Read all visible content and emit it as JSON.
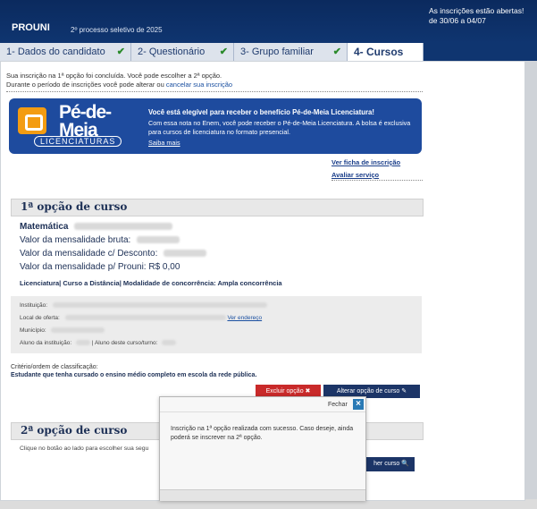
{
  "header": {
    "brand": "PROUNI",
    "process": "2º processo seletivo de 2025",
    "notice": "As inscrições estão abertas! de 30/06 a 04/07"
  },
  "tabs": [
    {
      "label": "1- Dados do candidato",
      "done": true
    },
    {
      "label": "2- Questionário",
      "done": true
    },
    {
      "label": "3- Grupo familiar",
      "done": true
    },
    {
      "label": "4- Cursos",
      "done": false,
      "active": true
    }
  ],
  "info": {
    "line1": "Sua inscrição na 1ª opção foi concluída. Você pode escolher a 2ª opção.",
    "line2": "Durante o período de inscrições você pode alterar ou",
    "cancel_link": "cancelar sua inscrição"
  },
  "banner": {
    "logo_main_1": "Pé-de-",
    "logo_main_2": "Meia",
    "logo_sub": "LICENCIATURAS",
    "title": "Você está elegível para receber o benefício Pé-de-Meia Licenciatura!",
    "text": "Com essa nota no Enem, você pode receber o Pé-de-Meia Licenciatura. A bolsa é exclusiva para cursos de licenciatura no formato presencial.",
    "link": "Saiba mais"
  },
  "links": {
    "ficha": "Ver ficha de inscrição",
    "avaliar": "Avaliar serviço"
  },
  "option1": {
    "title": "1ª opção de curso",
    "course": "Matemática",
    "bruta_label": "Valor da mensalidade bruta:",
    "desconto_label": "Valor da mensalidade c/ Desconto:",
    "prouni_label": "Valor da mensalidade p/ Prouni:",
    "prouni_value": "R$ 0,00",
    "tags": "Licenciatura| Curso a Distância| Modalidade de concorrência: Ampla concorrência",
    "instituicao_label": "Instituição:",
    "local_label": "Local de oferta:",
    "ver_endereco": "Ver endereço",
    "municipio_label": "Município:",
    "aluno_label": "Aluno da instituição:",
    "aluno_curso_label": "| Aluno deste curso/turno:",
    "criterio_label": "Critério/ordem de classificação:",
    "criterio_value": "Estudante que tenha cursado o ensino médio completo em escola da rede pública.",
    "excluir": "Excluir opção",
    "alterar": "Alterar opção de curso"
  },
  "option2": {
    "title": "2ª opção de curso",
    "text": "Clique no botão ao lado para escolher sua segu",
    "button": "her curso"
  },
  "modal": {
    "close_label": "Fechar",
    "message": "Inscrição na 1ª opção realizada com sucesso. Caso deseje, ainda poderá se inscrever na 2ª opção."
  }
}
